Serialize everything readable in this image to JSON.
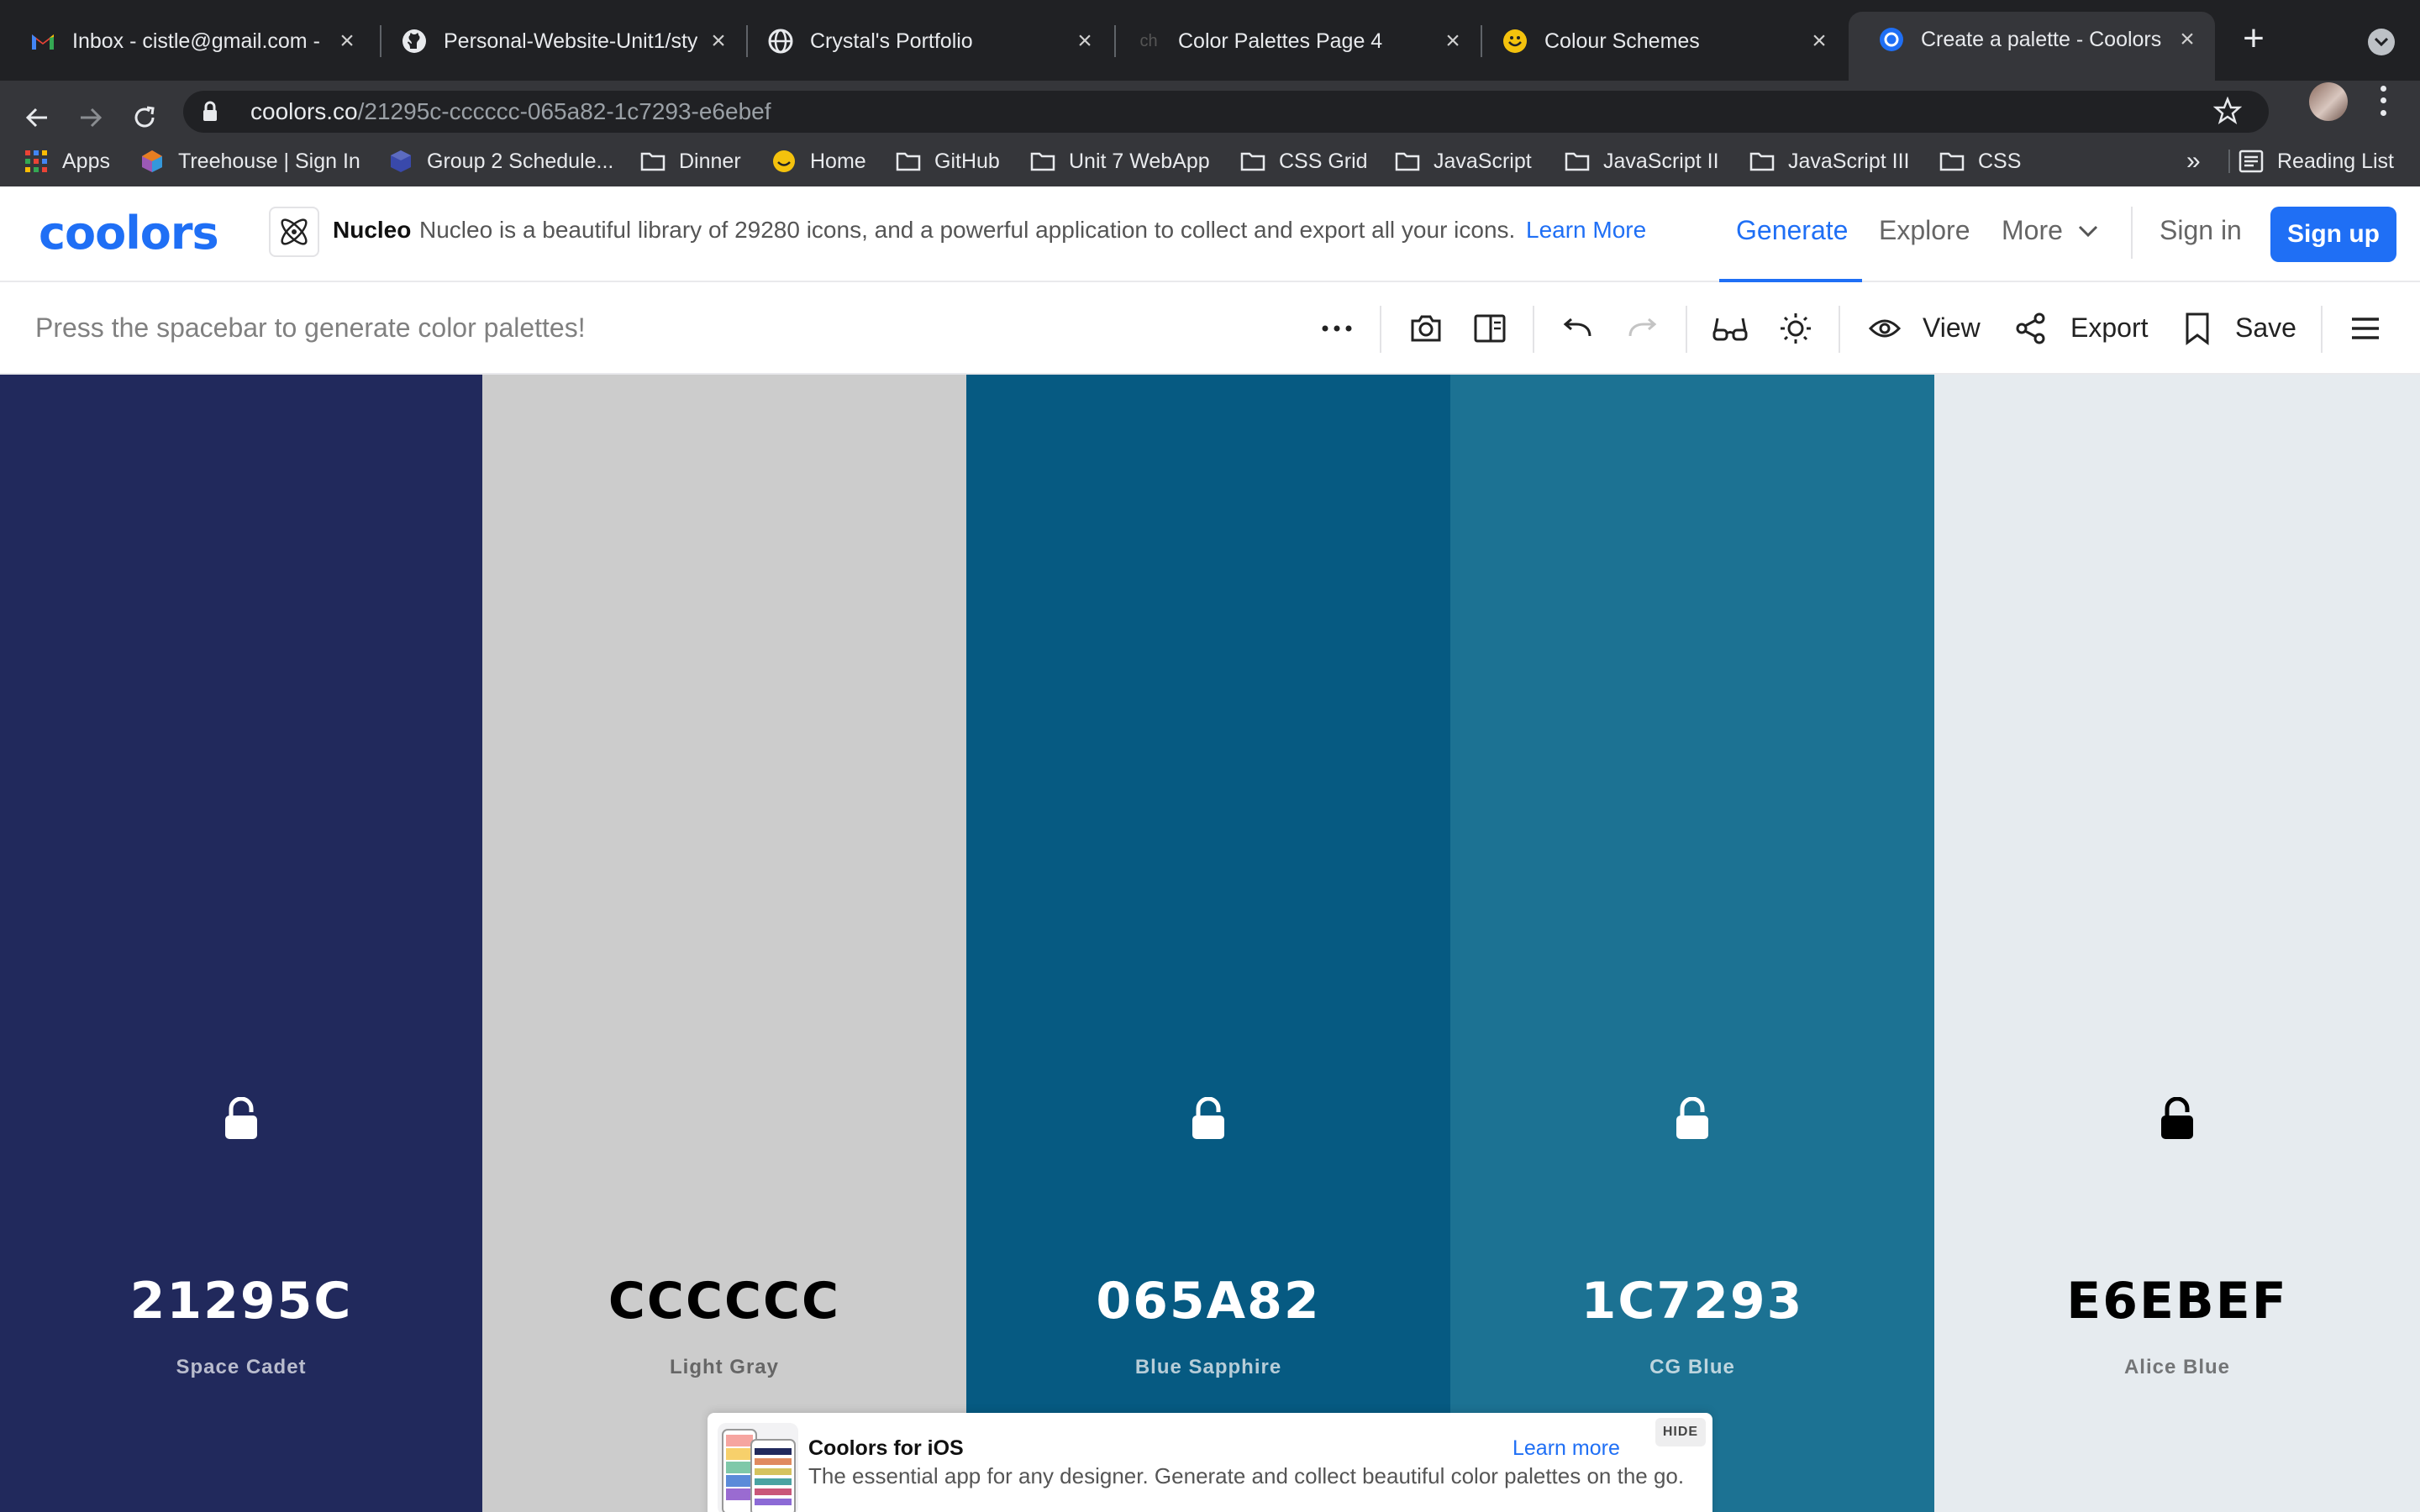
{
  "browser": {
    "tabs": [
      {
        "title": "Inbox - cistle@gmail.com -",
        "icon": "gmail-icon"
      },
      {
        "title": "Personal-Website-Unit1/sty",
        "icon": "github-icon"
      },
      {
        "title": "Crystal's Portfolio",
        "icon": "globe-icon"
      },
      {
        "title": "Color Palettes Page 4",
        "icon": "ch-icon"
      },
      {
        "title": "Colour Schemes",
        "icon": "smiley-icon"
      },
      {
        "title": "Create a palette - Coolors",
        "icon": "coolors-icon"
      }
    ],
    "url_host": "coolors.co",
    "url_path": "/21295c-cccccc-065a82-1c7293-e6ebef",
    "bookmarks": [
      "Apps",
      "Treehouse | Sign In",
      "Group 2 Schedule...",
      "Dinner",
      "Home",
      "GitHub",
      "Unit 7 WebApp",
      "CSS Grid",
      "JavaScript",
      "JavaScript II",
      "JavaScript III",
      "CSS"
    ],
    "bookmarks_more": "»",
    "reading_list": "Reading List"
  },
  "header": {
    "logo": "coolors",
    "ad_brand": "Nucleo",
    "ad_text": "Nucleo is a beautiful library of 29280 icons, and a powerful application to collect and export all your icons.",
    "ad_link": "Learn More",
    "nav": {
      "generate": "Generate",
      "explore": "Explore",
      "more": "More",
      "sign_in": "Sign in",
      "sign_up": "Sign up"
    },
    "accent_color": "#1f6ff5"
  },
  "toolbar": {
    "hint": "Press the spacebar to generate color palettes!",
    "view": "View",
    "export": "Export",
    "save": "Save"
  },
  "palette": [
    {
      "hex": "21295C",
      "name": "Space Cadet",
      "color": "#21295c",
      "text_color": "#ffffff",
      "name_color": "#b9bccd"
    },
    {
      "hex": "CCCCCC",
      "name": "Light Gray",
      "color": "#cccccc",
      "text_color": "#000000",
      "name_color": "#666666"
    },
    {
      "hex": "065A82",
      "name": "Blue Sapphire",
      "color": "#065a82",
      "text_color": "#ffffff",
      "name_color": "#b7cdd8"
    },
    {
      "hex": "1C7293",
      "name": "CG Blue",
      "color": "#1c7293",
      "text_color": "#ffffff",
      "name_color": "#bdd5de"
    },
    {
      "hex": "E6EBEF",
      "name": "Alice Blue",
      "color": "#e6ebef",
      "text_color": "#000000",
      "name_color": "#737577"
    }
  ],
  "promo": {
    "title": "Coolors for iOS",
    "description": "The essential app for any designer. Generate and collect beautiful color palettes on the go.",
    "link": "Learn more",
    "hide": "HIDE"
  }
}
